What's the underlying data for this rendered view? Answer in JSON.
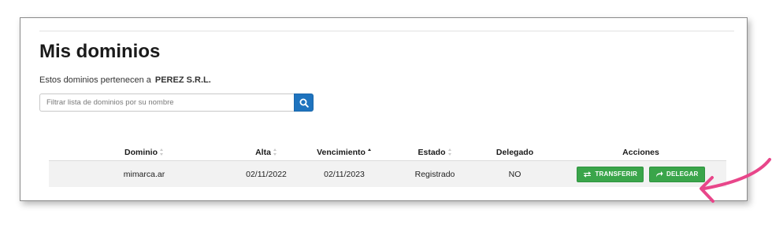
{
  "page": {
    "title": "Mis dominios",
    "subtitle_prefix": "Estos dominios pertenecen a",
    "owner": "PEREZ S.R.L."
  },
  "search": {
    "placeholder": "Filtrar lista de dominios por su nombre",
    "button_icon": "search-icon"
  },
  "table": {
    "columns": [
      {
        "label": "Dominio",
        "sort": "none"
      },
      {
        "label": "Alta",
        "sort": "none"
      },
      {
        "label": "Vencimiento",
        "sort": "asc"
      },
      {
        "label": "Estado",
        "sort": "none"
      },
      {
        "label": "Delegado",
        "sort": null
      },
      {
        "label": "Acciones",
        "sort": null
      }
    ],
    "rows": [
      {
        "dominio": "mimarca.ar",
        "alta": "02/11/2022",
        "vencimiento": "02/11/2023",
        "estado": "Registrado",
        "delegado": "NO",
        "actions": [
          {
            "label": "TRANSFERIR",
            "icon": "transfer-arrows-icon"
          },
          {
            "label": "DELEGAR",
            "icon": "share-arrow-icon"
          }
        ]
      }
    ]
  },
  "colors": {
    "primary": "#1e73be",
    "success": "#3aa54a",
    "annotation": "#e8468a"
  }
}
